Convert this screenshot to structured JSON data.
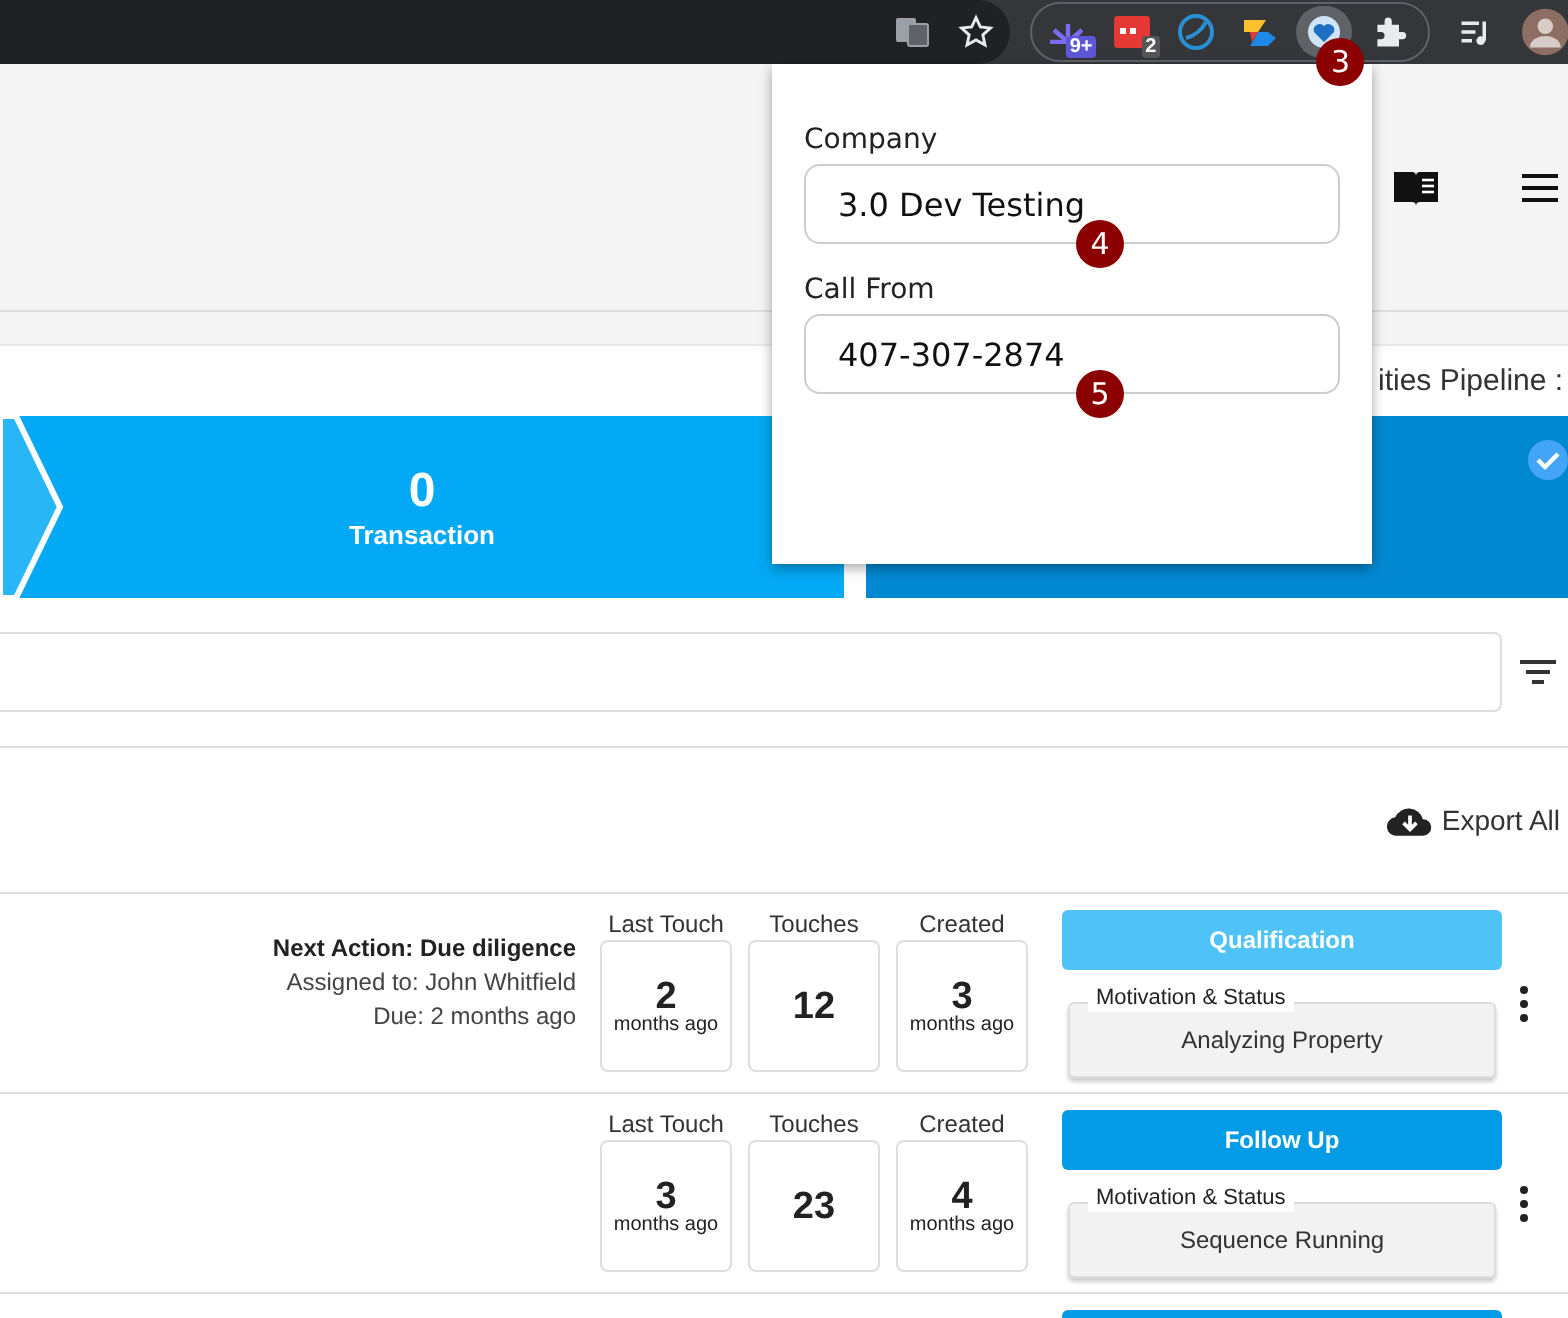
{
  "browser_toolbar": {
    "extensions": [
      {
        "kind": "burst",
        "badge": "9+",
        "selected": false
      },
      {
        "kind": "calendar",
        "badge": "2",
        "selected": false
      },
      {
        "kind": "globe",
        "selected": false
      },
      {
        "kind": "arrow",
        "selected": false
      },
      {
        "kind": "heart",
        "selected": true,
        "marker": "3"
      }
    ]
  },
  "pipeline_header": {
    "text": "ities Pipeline :"
  },
  "stages": [
    {
      "count": "0",
      "label": "Transaction",
      "selected": false
    },
    {
      "selected": true
    }
  ],
  "export_button": {
    "label": "Export All"
  },
  "rows": [
    {
      "next_action": "Next Action: Due diligence",
      "assigned": "Assigned to: John Whitfield",
      "due": "Due: 2 months ago",
      "stats": [
        {
          "label": "Last Touch",
          "value": "2",
          "unit": "months ago"
        },
        {
          "label": "Touches",
          "value": "12"
        },
        {
          "label": "Created",
          "value": "3",
          "unit": "months ago"
        }
      ],
      "stage": {
        "label": "Qualification",
        "color": "#4fc3f7"
      },
      "motivation": {
        "legend": "Motivation & Status",
        "value": "Analyzing Property"
      }
    },
    {
      "stats": [
        {
          "label": "Last Touch",
          "value": "3",
          "unit": "months ago"
        },
        {
          "label": "Touches",
          "value": "23"
        },
        {
          "label": "Created",
          "value": "4",
          "unit": "months ago"
        }
      ],
      "stage": {
        "label": "Follow Up",
        "color": "#039be5"
      },
      "motivation": {
        "legend": "Motivation & Status",
        "value": "Sequence Running"
      }
    }
  ],
  "popup": {
    "fields": [
      {
        "label": "Company",
        "value": "3.0 Dev Testing",
        "marker": "4"
      },
      {
        "label": "Call From",
        "value": "407-307-2874",
        "marker": "5"
      }
    ]
  }
}
